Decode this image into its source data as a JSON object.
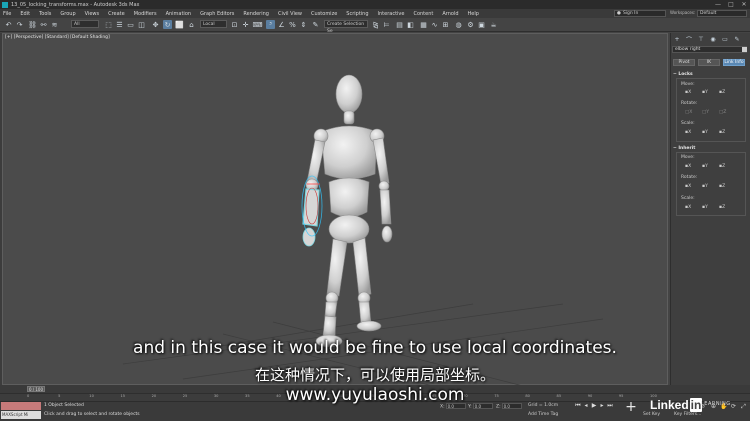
{
  "window": {
    "title": "13_05_locking_transforms.max - Autodesk 3ds Max",
    "minimize": "—",
    "maximize": "□",
    "close": "✕"
  },
  "menu": {
    "items": [
      "File",
      "Edit",
      "Tools",
      "Group",
      "Views",
      "Create",
      "Modifiers",
      "Animation",
      "Graph Editors",
      "Rendering",
      "Civil View",
      "Customize",
      "Scripting",
      "Interactive",
      "Content",
      "Arnold",
      "Help"
    ],
    "sign_in": "Sign In",
    "workspaces_label": "Workspaces:",
    "workspace_value": "Default"
  },
  "toolbar": {
    "selection_filter": "All",
    "reference_coord": "Local",
    "selection_set": "Create Selection Se"
  },
  "viewport": {
    "label": "[+] [Perspective] [Standard] [Default Shading]"
  },
  "command_panel": {
    "object_name": "elbow right",
    "buttons": [
      "Pivot",
      "IK",
      "Link Info"
    ],
    "locks": {
      "header": "Locks",
      "move_label": "Move:",
      "rotate_label": "Rotate:",
      "scale_label": "Scale:",
      "move": [
        "X",
        "Y",
        "Z"
      ],
      "rotate": [
        "X",
        "Y",
        "Z"
      ],
      "scale": [
        "X",
        "Y",
        "Z"
      ]
    },
    "inherit": {
      "header": "Inherit",
      "move_label": "Move:",
      "rotate_label": "Rotate:",
      "scale_label": "Scale:",
      "move": [
        "X",
        "Y",
        "Z"
      ],
      "rotate": [
        "X",
        "Y",
        "Z"
      ],
      "scale": [
        "X",
        "Y",
        "Z"
      ]
    }
  },
  "timeline": {
    "frame_display": "0 / 100",
    "ticks": [
      "0",
      "5",
      "10",
      "15",
      "20",
      "25",
      "30",
      "35",
      "40",
      "45",
      "50",
      "55",
      "60",
      "65",
      "70",
      "75",
      "80",
      "85",
      "90",
      "95",
      "100"
    ]
  },
  "status": {
    "maxscript": "MAXScript Mi",
    "selection": "1 Object Selected",
    "prompt": "Click and drag to select and rotate objects",
    "x_label": "X:",
    "x_value": "0.0",
    "y_label": "Y:",
    "y_value": "0.0",
    "z_label": "Z:",
    "z_value": "0.0",
    "grid": "Grid = 1.0cm",
    "add_time_tag": "Add Time Tag",
    "set_key": "Set Key",
    "key_filters": "Key Filters..."
  },
  "subtitles": {
    "english": "and in this case it would be fine to use local coordinates.",
    "chinese": "在这种情况下，可以使用局部坐标。",
    "url": "www.yuyulaoshi.com"
  },
  "watermark": {
    "linked": "Linked",
    "in": "in",
    "learning": "LEARNING"
  }
}
